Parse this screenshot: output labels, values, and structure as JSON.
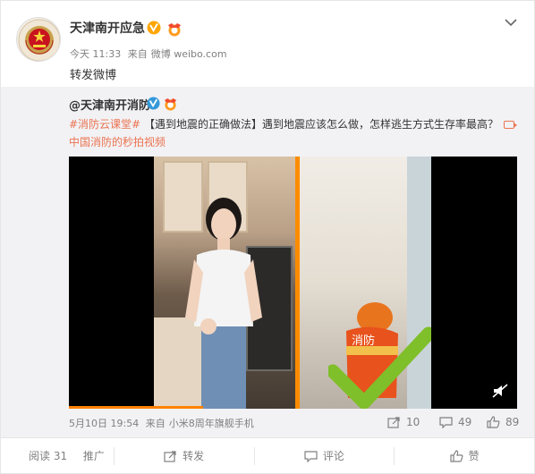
{
  "post": {
    "author": "天津南开应急",
    "timestamp": "今天 11:33",
    "source_prefix": "来自",
    "source": "微博 weibo.com",
    "text": "转发微博"
  },
  "quoted": {
    "author": "@天津南开消防",
    "hashtag": "#消防云课堂#",
    "title": "【遇到地震的正确做法】",
    "body": "遇到地震应该怎么做，怎样逃生方式生存率最高？",
    "link_text": "中国消防的秒拍视频",
    "date": "5月10日 19:54",
    "source_prefix": "来自",
    "source": "小米8周年旗舰手机",
    "forward_count": "10",
    "comment_count": "49",
    "like_count": "89",
    "video": {
      "fire_label": "消防",
      "progress_fraction": 0.3
    }
  },
  "bottom_bar": {
    "reads": "阅读 31",
    "promote": "推广",
    "forward": "转发",
    "comment": "评论",
    "like": "赞"
  },
  "colors": {
    "accent_link": "#eb7350",
    "verified": "#ffa500",
    "divider_orange": "#ff8c00",
    "check_green": "#7fbf2a"
  }
}
